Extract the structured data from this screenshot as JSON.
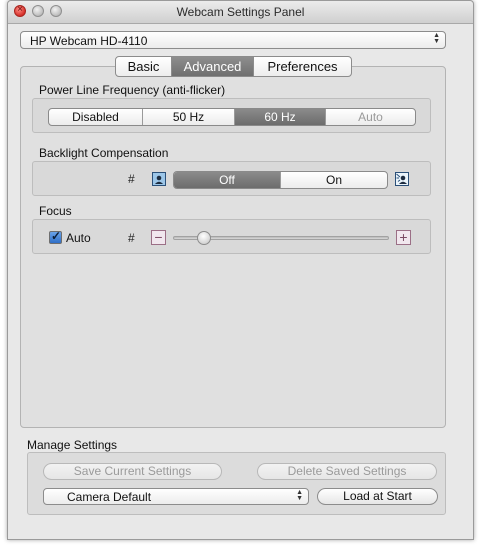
{
  "window": {
    "title": "Webcam Settings Panel"
  },
  "device": {
    "selected": "HP Webcam HD-4110"
  },
  "tabs": [
    {
      "label": "Basic",
      "selected": false
    },
    {
      "label": "Advanced",
      "selected": true
    },
    {
      "label": "Preferences",
      "selected": false
    }
  ],
  "power_line": {
    "label": "Power Line Frequency (anti-flicker)",
    "options": [
      "Disabled",
      "50 Hz",
      "60 Hz",
      "Auto"
    ],
    "selected": "60 Hz",
    "disabled_options": [
      "Auto"
    ]
  },
  "backlight": {
    "label": "Backlight Compensation",
    "marker": "#",
    "options": [
      "Off",
      "On"
    ],
    "selected": "Off",
    "left_icon": "backlight-low-icon",
    "right_icon": "backlight-high-icon"
  },
  "focus": {
    "label": "Focus",
    "auto_label": "Auto",
    "auto_checked": true,
    "marker": "#",
    "slider_fraction": 0.12,
    "minus_icon": "minus-icon",
    "plus_icon": "plus-icon"
  },
  "manage": {
    "label": "Manage Settings",
    "save_label": "Save Current Settings",
    "delete_label": "Delete Saved Settings",
    "preset": "Camera Default",
    "load_label": "Load at Start"
  },
  "colors": {
    "selected_segment": "#6c6c6c",
    "checkbox": "#2f6fc7",
    "stepper_border": "#9b6f86"
  }
}
